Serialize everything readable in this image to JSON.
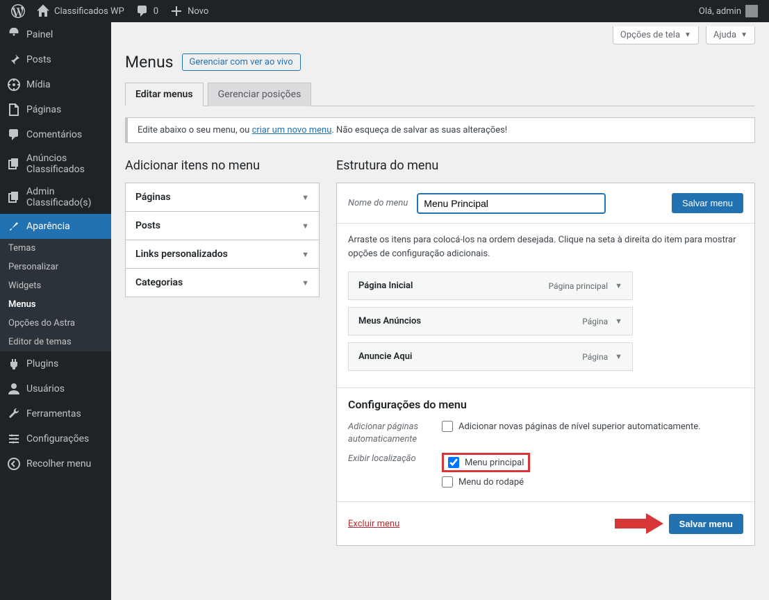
{
  "adminBar": {
    "siteTitle": "Classificados WP",
    "commentsCount": "0",
    "newLabel": "Novo",
    "greeting": "Olá, admin"
  },
  "sidebar": {
    "dashboard": "Painel",
    "posts": "Posts",
    "media": "Mídia",
    "pages": "Páginas",
    "comments": "Comentários",
    "ads": "Anúncios Classificados",
    "adminAds": "Admin Classificado(s)",
    "appearance": "Aparência",
    "sub": {
      "themes": "Temas",
      "customize": "Personalizar",
      "widgets": "Widgets",
      "menus": "Menus",
      "astra": "Opções do Astra",
      "editor": "Editor de temas"
    },
    "plugins": "Plugins",
    "users": "Usuários",
    "tools": "Ferramentas",
    "settings": "Configurações",
    "collapse": "Recolher menu"
  },
  "screenMeta": {
    "options": "Opções de tela",
    "help": "Ajuda"
  },
  "header": {
    "title": "Menus",
    "liveAction": "Gerenciar com ver ao vivo"
  },
  "tabs": {
    "edit": "Editar menus",
    "locations": "Gerenciar posições"
  },
  "notice": {
    "pre": "Edite abaixo o seu menu, ou ",
    "link": "criar um novo menu",
    "post": ". Não esqueça de salvar as suas alterações!"
  },
  "leftCol": {
    "heading": "Adicionar itens no menu",
    "acc": {
      "pages": "Páginas",
      "posts": "Posts",
      "custom": "Links personalizados",
      "cats": "Categorias"
    }
  },
  "rightCol": {
    "heading": "Estrutura do menu",
    "nameLabel": "Nome do menu",
    "nameValue": "Menu Principal",
    "saveTop": "Salvar menu",
    "desc": "Arraste os itens para colocá-los na ordem desejada. Clique na seta à direita do item para mostrar opções de configuração adicionais.",
    "items": [
      {
        "title": "Página Inicial",
        "type": "Página principal"
      },
      {
        "title": "Meus Anúncios",
        "type": "Página"
      },
      {
        "title": "Anuncie Aqui",
        "type": "Página"
      }
    ],
    "settingsTitle": "Configurações do menu",
    "autoAddLabel": "Adicionar páginas automaticamente",
    "autoAddCheckbox": "Adicionar novas páginas de nível superior automaticamente.",
    "locationLabel": "Exibir localização",
    "loc1": "Menu principal",
    "loc2": "Menu do rodapé",
    "deleteLink": "Excluir menu",
    "saveBottom": "Salvar menu"
  }
}
